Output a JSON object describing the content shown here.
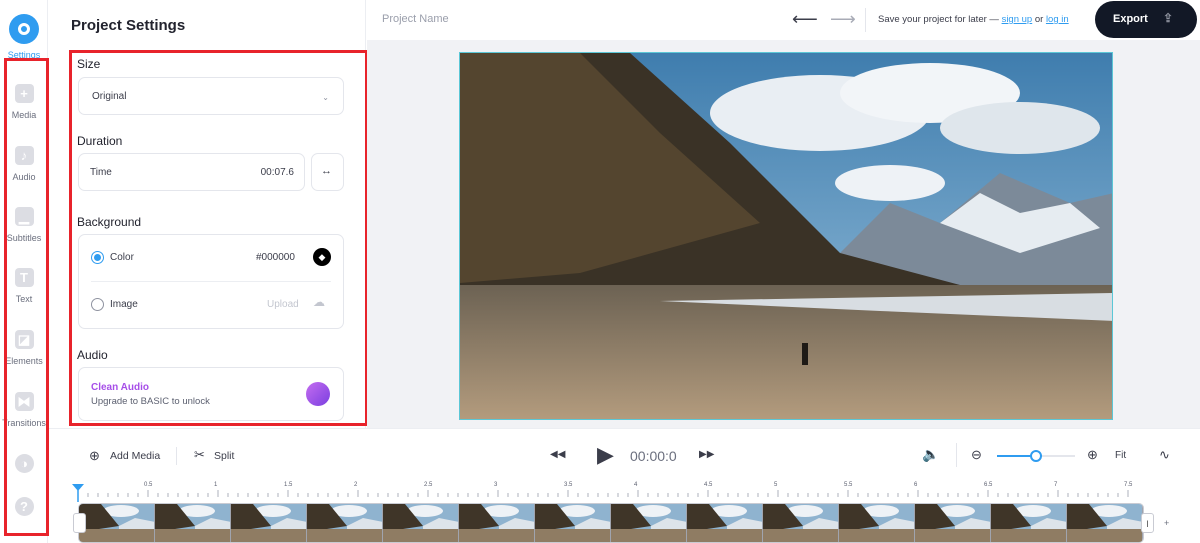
{
  "sidebar": {
    "items": [
      {
        "label": "Settings",
        "icon": "settings-icon"
      },
      {
        "label": "Media",
        "icon": "plus-icon"
      },
      {
        "label": "Audio",
        "icon": "music-note-icon"
      },
      {
        "label": "Subtitles",
        "icon": "subtitles-icon"
      },
      {
        "label": "Text",
        "icon": "text-icon"
      },
      {
        "label": "Elements",
        "icon": "sticker-icon"
      },
      {
        "label": "Transitions",
        "icon": "transition-icon"
      },
      {
        "label": "",
        "icon": "contrast-icon"
      },
      {
        "label": "",
        "icon": "help-icon"
      }
    ]
  },
  "panel": {
    "title": "Project Settings",
    "size": {
      "label": "Size",
      "value": "Original"
    },
    "duration": {
      "label": "Duration",
      "time_label": "Time",
      "time_value": "00:07.6"
    },
    "background": {
      "label": "Background",
      "color_label": "Color",
      "color_value": "#000000",
      "image_label": "Image",
      "upload_label": "Upload"
    },
    "audio": {
      "label": "Audio",
      "clean_title": "Clean Audio",
      "clean_sub": "Upgrade to BASIC to unlock"
    }
  },
  "topbar": {
    "project_name": "Project Name",
    "save_prefix": "Save your project for later — ",
    "sign_up": "sign up",
    "or": " or ",
    "log_in": "log in",
    "export_label": "Export"
  },
  "controls": {
    "add_media": "Add Media",
    "split": "Split",
    "time": "00:00:0",
    "fit": "Fit",
    "zoom_level": 0.5
  },
  "timeline": {
    "ticks": [
      "0.5",
      "1",
      "1.5",
      "2",
      "2.5",
      "3",
      "3.5",
      "4",
      "4.5",
      "5",
      "5.5",
      "6",
      "6.5",
      "7",
      "7.5"
    ],
    "end_handle": "I",
    "add_label": "+"
  },
  "colors": {
    "accent": "#2f9cf0",
    "annotation": "#e8232b",
    "export_bg": "#121826",
    "clean_audio": "#a64ee8"
  }
}
